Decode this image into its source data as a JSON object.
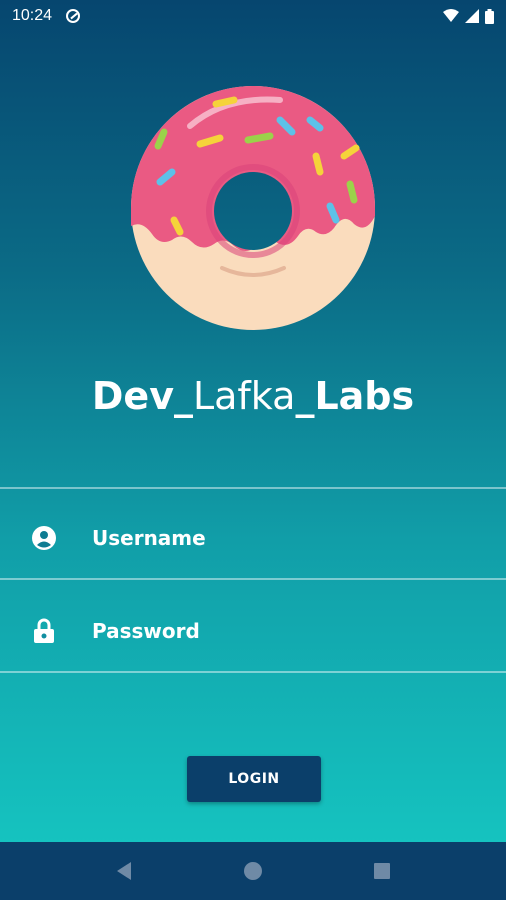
{
  "status_bar": {
    "time": "10:24",
    "icons": [
      "sync-icon",
      "wifi-icon",
      "signal-icon",
      "battery-icon"
    ]
  },
  "logo": {
    "name": "donut-logo"
  },
  "brand": {
    "part1": "Dev",
    "sep1": "_",
    "part2": "Lafka",
    "sep2": "_",
    "part3": "Labs"
  },
  "form": {
    "username_placeholder": "Username",
    "username_icon": "account-icon",
    "password_placeholder": "Password",
    "password_icon": "lock-icon",
    "login_label": "LOGIN"
  },
  "nav_bar": {
    "icons": [
      "back-icon",
      "home-icon",
      "recents-icon"
    ]
  },
  "colors": {
    "gradient_top": "#06466f",
    "gradient_bottom": "#16cac4",
    "button": "#0b3f6a",
    "frosting": "#ea5a83",
    "dough": "#fadcbd"
  }
}
